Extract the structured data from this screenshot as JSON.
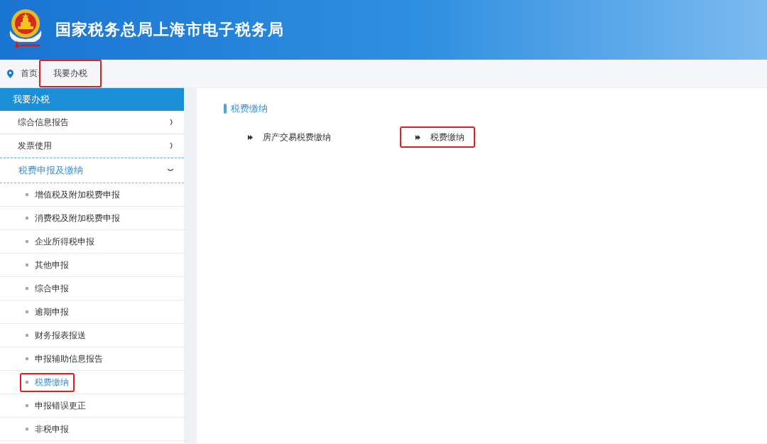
{
  "header": {
    "title": "国家税务总局上海市电子税务局"
  },
  "breadcrumb": [
    {
      "label": "首页",
      "highlighted": false
    },
    {
      "label": "我要办税",
      "highlighted": true
    }
  ],
  "sidebar": {
    "title": "我要办税",
    "groups": [
      {
        "label": "综合信息报告",
        "expanded": false
      },
      {
        "label": "发票使用",
        "expanded": false
      },
      {
        "label": "税费申报及缴纳",
        "expanded": true,
        "children": [
          {
            "label": "增值税及附加税费申报",
            "selected": false,
            "highlighted": false
          },
          {
            "label": "消费税及附加税费申报",
            "selected": false,
            "highlighted": false
          },
          {
            "label": "企业所得税申报",
            "selected": false,
            "highlighted": false
          },
          {
            "label": "其他申报",
            "selected": false,
            "highlighted": false
          },
          {
            "label": "综合申报",
            "selected": false,
            "highlighted": false
          },
          {
            "label": "逾期申报",
            "selected": false,
            "highlighted": false
          },
          {
            "label": "财务报表报送",
            "selected": false,
            "highlighted": false
          },
          {
            "label": "申报辅助信息报告",
            "selected": false,
            "highlighted": false
          },
          {
            "label": "税费缴纳",
            "selected": true,
            "highlighted": true
          },
          {
            "label": "申报错误更正",
            "selected": false,
            "highlighted": false
          },
          {
            "label": "非税申报",
            "selected": false,
            "highlighted": false
          }
        ]
      }
    ]
  },
  "content": {
    "section_title": "税费缴纳",
    "links": [
      {
        "label": "房产交易税费缴纳",
        "highlighted": false
      },
      {
        "label": "税费缴纳",
        "highlighted": true
      }
    ]
  }
}
